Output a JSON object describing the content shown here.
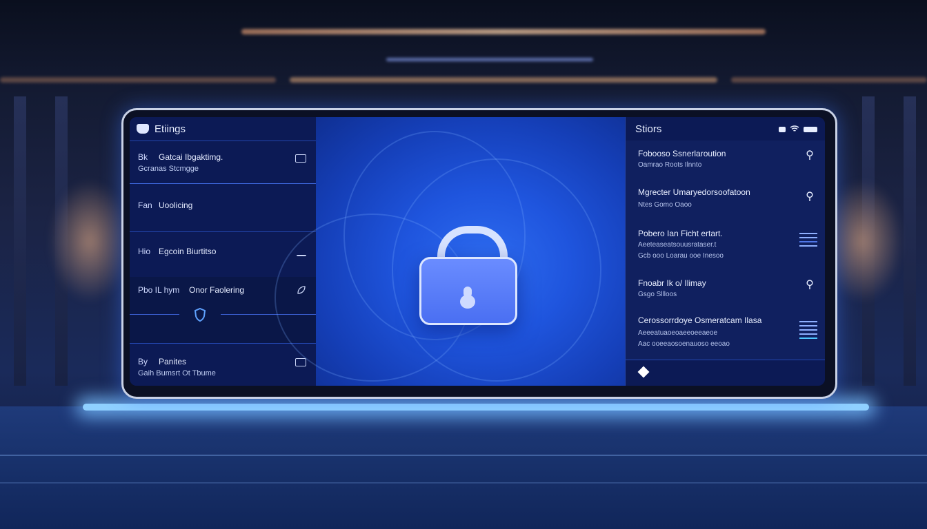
{
  "left_panel": {
    "title": "Etiings",
    "rows": [
      {
        "prefix": "Bk",
        "label": "Gatcai Ibgaktimg.",
        "sub": "Gcranas Stcmgge"
      },
      {
        "prefix": "Fan",
        "label": "Uoolicing",
        "sub": ""
      },
      {
        "prefix": "Hio",
        "label": "Egcoin Biurtitso",
        "sub": ""
      },
      {
        "prefix": "Pbo  IL  hym",
        "label": "Onor Faolering",
        "sub": ""
      },
      {
        "prefix": "By",
        "label": "Panites",
        "sub": "Gaih Bumsrt Ot Tbume"
      }
    ]
  },
  "right_panel": {
    "title": "Stiors",
    "rows": [
      {
        "label": "Fobooso Ssnerlaroution",
        "sub": "Oamrao Roots Ilnnto",
        "icon": "pin-icon"
      },
      {
        "label": "Mgrecter Umaryedorsoofatoon",
        "sub": "Ntes Gomo Oaoo",
        "icon": "pin-icon"
      },
      {
        "label": "Pobero Ian Ficht ertart.",
        "sub": "Aeeteaseatsouusrataser.t",
        "sub2": "Gcb ooo Loarau ooe Inesoo",
        "icon": "list-icon"
      },
      {
        "label": "Fnoabr Ik o/ Ilimay",
        "sub": "Gsgo Sllloos",
        "icon": "pin-icon"
      },
      {
        "label": "Cerossorrdoye Osmeratcam Ilasa",
        "sub": "Aeeeatuaoeoaeeoeeaeoe",
        "sub2": "Aac ooeeaosoenauoso eeoao",
        "icon": "bars-icon"
      }
    ]
  },
  "colors": {
    "panel": "#0c1a55",
    "accent": "#2e6cf0",
    "lock": "#5a7dfa"
  }
}
